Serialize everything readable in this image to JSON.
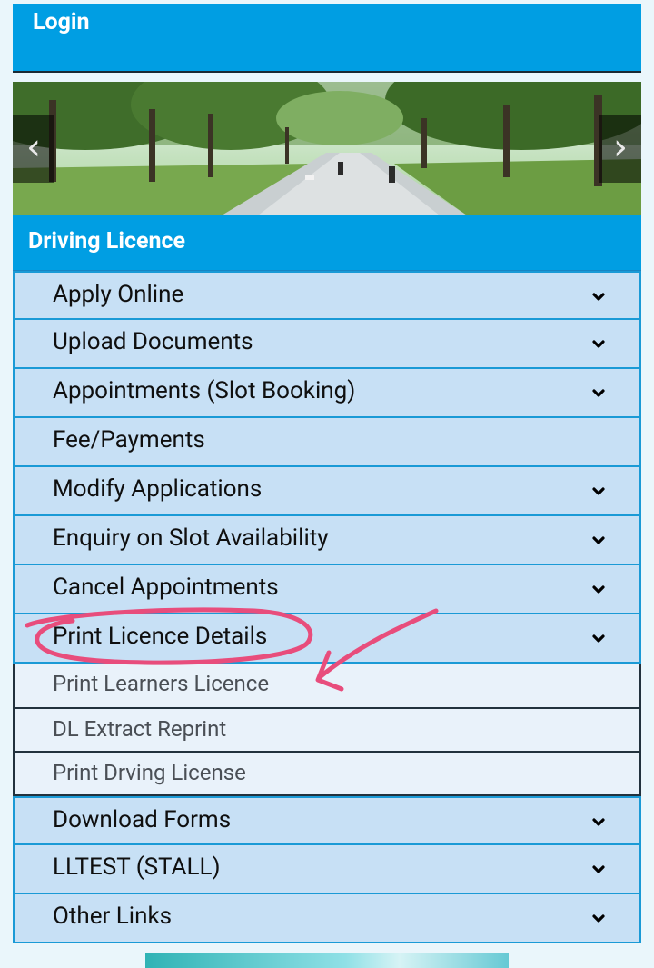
{
  "login": {
    "label": "Login"
  },
  "carousel": {
    "prev_icon": "chevron-left-icon",
    "next_icon": "chevron-right-icon",
    "prev_glyph": "‹",
    "next_glyph": "›"
  },
  "section": {
    "title": "Driving Licence"
  },
  "menu": {
    "items": [
      {
        "label": "Apply Online",
        "icon": "chevron-down-icon"
      },
      {
        "label": "Upload Documents",
        "icon": "chevron-down-icon"
      },
      {
        "label": "Appointments (Slot Booking)",
        "icon": "chevron-down-icon"
      },
      {
        "label": "Fee/Payments"
      },
      {
        "label": "Modify Applications",
        "icon": "chevron-down-icon"
      },
      {
        "label": "Enquiry on Slot Availability",
        "icon": "chevron-down-icon"
      },
      {
        "label": "Cancel Appointments",
        "icon": "chevron-down-icon"
      },
      {
        "label": "Print Licence Details",
        "icon": "chevron-down-icon",
        "expanded": true
      }
    ],
    "submenu": [
      {
        "label": "Print Learners Licence"
      },
      {
        "label": "DL Extract Reprint"
      },
      {
        "label": "Print Drving License"
      }
    ],
    "items_after": [
      {
        "label": "Download Forms",
        "icon": "chevron-down-icon"
      },
      {
        "label": "LLTEST (STALL)",
        "icon": "chevron-down-icon"
      },
      {
        "label": "Other Links",
        "icon": "chevron-down-icon"
      }
    ]
  },
  "colors": {
    "header_blue": "#009ee3",
    "menu_bg": "#c7e0f5",
    "menu_border": "#1a9ad6",
    "submenu_bg": "#e9f2fa",
    "annotation": "#e84d7c"
  }
}
